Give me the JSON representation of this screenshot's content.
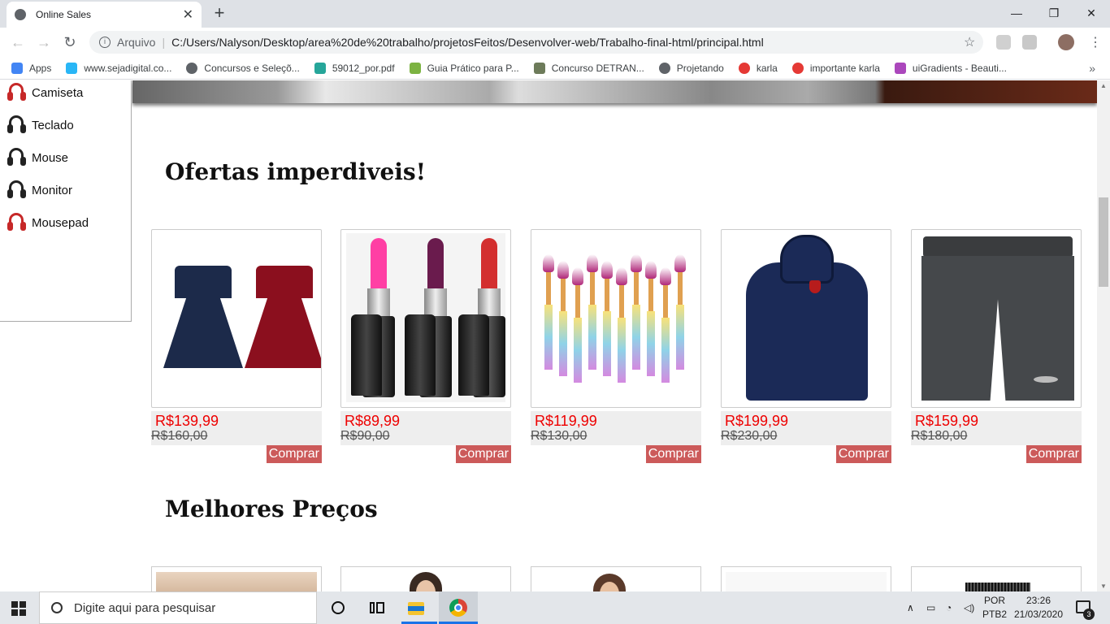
{
  "browser": {
    "tab_title": "Online Sales",
    "tab_close": "✕",
    "new_tab": "+",
    "window_controls": {
      "minimize": "—",
      "maximize": "❐",
      "close": "✕"
    },
    "nav": {
      "back": "←",
      "forward": "→",
      "reload": "↻"
    },
    "address": {
      "info": "i",
      "label": "Arquivo",
      "separator": "|",
      "url": "C:/Users/Nalyson/Desktop/area%20de%20trabalho/projetosFeitos/Desenvolver-web/Trabalho-final-html/principal.html"
    },
    "star": "☆",
    "menu": "⋮",
    "bookmarks": [
      {
        "label": "Apps",
        "icon": "apps-grid-icon",
        "color": "#4285f4"
      },
      {
        "label": "www.sejadigital.co...",
        "icon": "robot-icon",
        "color": "#29b6f6"
      },
      {
        "label": "Concursos e Seleçõ...",
        "icon": "globe-icon",
        "color": "#5f6368"
      },
      {
        "label": "59012_por.pdf",
        "icon": "pdf-icon",
        "color": "#26a69a"
      },
      {
        "label": "Guia Prático para P...",
        "icon": "leaf-icon",
        "color": "#7cb342"
      },
      {
        "label": "Concurso DETRAN...",
        "icon": "badge-icon",
        "color": "#6d7b5a"
      },
      {
        "label": "Projetando",
        "icon": "globe-icon",
        "color": "#5f6368"
      },
      {
        "label": "karla",
        "icon": "e-icon",
        "color": "#e53935"
      },
      {
        "label": "importante karla",
        "icon": "e-icon",
        "color": "#e53935"
      },
      {
        "label": "uiGradients - Beauti...",
        "icon": "gradient-icon",
        "color": "#ab47bc"
      }
    ],
    "bookmarks_more": "»"
  },
  "side_menu": {
    "items": [
      {
        "label": "Camiseta",
        "color": "#c62828"
      },
      {
        "label": "Teclado",
        "color": "#222222"
      },
      {
        "label": "Mouse",
        "color": "#222222"
      },
      {
        "label": "Monitor",
        "color": "#222222"
      },
      {
        "label": "Mousepad",
        "color": "#c62828"
      }
    ]
  },
  "sections": {
    "offers_title": "Ofertas imperdiveis!",
    "best_prices_title": "Melhores Preços"
  },
  "products": [
    {
      "name": "dress",
      "price": "R$139,99",
      "old_price": "R$160,00",
      "buy": "Comprar"
    },
    {
      "name": "lipstick",
      "price": "R$89,99",
      "old_price": "R$90,00",
      "buy": "Comprar"
    },
    {
      "name": "brushes",
      "price": "R$119,99",
      "old_price": "R$130,00",
      "buy": "Comprar"
    },
    {
      "name": "hoodie",
      "price": "R$199,99",
      "old_price": "R$230,00",
      "buy": "Comprar"
    },
    {
      "name": "shorts",
      "price": "R$159,99",
      "old_price": "R$180,00",
      "buy": "Comprar"
    }
  ],
  "taskbar": {
    "search_placeholder": "Digite aqui para pesquisar",
    "lang_top": "POR",
    "lang_bottom": "PTB2",
    "time": "23:26",
    "date": "21/03/2020",
    "notifications": "3"
  },
  "colors": {
    "price": "#e00000",
    "buy_button": "#cc5a5a",
    "price_box": "#eeeeee"
  }
}
